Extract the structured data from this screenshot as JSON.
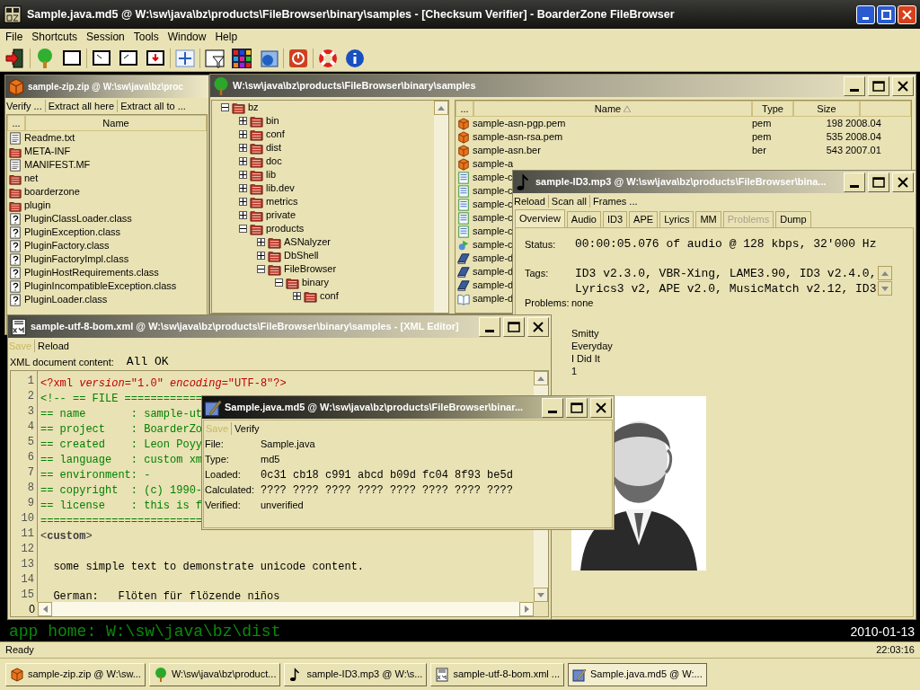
{
  "window": {
    "title": "Sample.java.md5 @ W:\\sw\\java\\bz\\products\\FileBrowser\\binary\\samples - [Checksum Verifier] - BoarderZone FileBrowser"
  },
  "menu": [
    "File",
    "Shortcuts",
    "Session",
    "Tools",
    "Window",
    "Help"
  ],
  "zip_window": {
    "title": "sample-zip.zip @ W:\\sw\\java\\bz\\proc",
    "actions": [
      "Verify ...",
      "Extract all here",
      "Extract all to ..."
    ],
    "columns": [
      "...",
      "Name"
    ],
    "rows": [
      {
        "name": "Readme.txt",
        "kind": "text"
      },
      {
        "name": "META-INF",
        "kind": "folder"
      },
      {
        "name": "MANIFEST.MF",
        "kind": "text"
      },
      {
        "name": "net",
        "kind": "folder"
      },
      {
        "name": "boarderzone",
        "kind": "folder"
      },
      {
        "name": "plugin",
        "kind": "folder"
      },
      {
        "name": "PluginClassLoader.class",
        "kind": "unknown"
      },
      {
        "name": "PluginException.class",
        "kind": "unknown"
      },
      {
        "name": "PluginFactory.class",
        "kind": "unknown"
      },
      {
        "name": "PluginFactoryImpl.class",
        "kind": "unknown"
      },
      {
        "name": "PluginHostRequirements.class",
        "kind": "unknown"
      },
      {
        "name": "PluginIncompatibleException.class",
        "kind": "unknown"
      },
      {
        "name": "PluginLoader.class",
        "kind": "unknown"
      }
    ]
  },
  "tree_window": {
    "title": "W:\\sw\\java\\bz\\products\\FileBrowser\\binary\\samples",
    "tree": [
      {
        "label": "bz",
        "expanded": true,
        "children": [
          {
            "label": "bin",
            "expanded": false
          },
          {
            "label": "conf",
            "expanded": false
          },
          {
            "label": "dist",
            "expanded": false
          },
          {
            "label": "doc",
            "expanded": false
          },
          {
            "label": "lib",
            "expanded": false
          },
          {
            "label": "lib.dev",
            "expanded": false
          },
          {
            "label": "metrics",
            "expanded": false
          },
          {
            "label": "private",
            "expanded": false
          },
          {
            "label": "products",
            "expanded": true,
            "children": [
              {
                "label": "ASNalyzer",
                "expanded": false
              },
              {
                "label": "DbShell",
                "expanded": false
              },
              {
                "label": "FileBrowser",
                "expanded": true,
                "children": [
                  {
                    "label": "binary",
                    "expanded": true,
                    "children": [
                      {
                        "label": "conf",
                        "expanded": false
                      }
                    ]
                  }
                ]
              }
            ]
          }
        ]
      }
    ],
    "columns": [
      {
        "label": "...",
        "sorted": false
      },
      {
        "label": "Name",
        "sorted": true
      },
      {
        "label": "Type",
        "sorted": false
      },
      {
        "label": "Size",
        "sorted": false
      }
    ],
    "files": [
      {
        "name": "sample-asn-pgp.pem",
        "type": "pem",
        "size": "198",
        "date": "2008.04",
        "kind": "package"
      },
      {
        "name": "sample-asn-rsa.pem",
        "type": "pem",
        "size": "535",
        "date": "2008.04",
        "kind": "package"
      },
      {
        "name": "sample-asn.ber",
        "type": "ber",
        "size": "543",
        "date": "2007.01",
        "kind": "package"
      },
      {
        "name": "sample-a",
        "kind": "package"
      },
      {
        "name": "sample-c",
        "kind": "sheet"
      },
      {
        "name": "sample-c",
        "kind": "sheet"
      },
      {
        "name": "sample-c",
        "kind": "sheet"
      },
      {
        "name": "sample-c",
        "kind": "sheet"
      },
      {
        "name": "sample-c",
        "kind": "sheet"
      },
      {
        "name": "sample-c",
        "kind": "script"
      },
      {
        "name": "sample-d",
        "kind": "book"
      },
      {
        "name": "sample-d",
        "kind": "book"
      },
      {
        "name": "sample-d",
        "kind": "book"
      },
      {
        "name": "sample-d",
        "kind": "manual"
      }
    ]
  },
  "id3_window": {
    "title": "sample-ID3.mp3 @ W:\\sw\\java\\bz\\products\\FileBrowser\\bina...",
    "actions": [
      "Reload",
      "Scan all",
      "Frames ..."
    ],
    "tabs": [
      {
        "label": "Overview",
        "selected": true,
        "disabled": false
      },
      {
        "label": "Audio",
        "selected": false,
        "disabled": false
      },
      {
        "label": "ID3",
        "selected": false,
        "disabled": false
      },
      {
        "label": "APE",
        "selected": false,
        "disabled": false
      },
      {
        "label": "Lyrics",
        "selected": false,
        "disabled": false
      },
      {
        "label": "MM",
        "selected": false,
        "disabled": false
      },
      {
        "label": "Problems",
        "selected": false,
        "disabled": true
      },
      {
        "label": "Dump",
        "selected": false,
        "disabled": false
      }
    ],
    "status_label": "Status:",
    "status": "00:00:05.076 of audio @ 128 kbps, 32'000 Hz",
    "tags_label": "Tags:",
    "tags": [
      "ID3 v2.3.0, VBR-Xing, LAME3.90, ID3 v2.4.0,",
      "Lyrics3 v2, APE v2.0, MusicMatch v2.12, ID3"
    ],
    "problems_label": "Problems:",
    "problems": "none",
    "info": [
      "Smitty",
      "Everyday",
      "I Did It",
      "1"
    ]
  },
  "xml_window": {
    "title": "sample-utf-8-bom.xml @ W:\\sw\\java\\bz\\products\\FileBrowser\\binary\\samples - [XML Editor]",
    "actions": [
      {
        "label": "Save",
        "disabled": true
      },
      {
        "label": "Reload",
        "disabled": false
      }
    ],
    "content_label": "XML document content:",
    "content_status": "All OK",
    "lines": [
      {
        "number": "1",
        "kind": "declaration",
        "text": "<?xml *version*=\"1.0\" *encoding*=\"UTF-8\"?>"
      },
      {
        "number": "2",
        "kind": "comment",
        "text": "<!-- == FILE ============"
      },
      {
        "number": "3",
        "kind": "comment",
        "text": "== name       : sample-ut"
      },
      {
        "number": "4",
        "kind": "comment",
        "text": "== project    : BoarderZo"
      },
      {
        "number": "5",
        "kind": "comment",
        "text": "== created    : Leon Poyy"
      },
      {
        "number": "6",
        "kind": "comment",
        "text": "== language   : custom xm"
      },
      {
        "number": "7",
        "kind": "comment",
        "text": "== environment: -"
      },
      {
        "number": "8",
        "kind": "comment",
        "text": "== copyright  : (c) 1990-"
      },
      {
        "number": "9",
        "kind": "comment",
        "text": "== license    : this is f"
      },
      {
        "number": "10",
        "kind": "comment",
        "text": "========================="
      },
      {
        "number": "11",
        "kind": "element",
        "text": "<**custom**>"
      },
      {
        "number": "12",
        "kind": "blank"
      },
      {
        "number": "13",
        "kind": "text",
        "text": "  some simple text to demonstrate unicode content."
      },
      {
        "number": "14",
        "kind": "blank"
      },
      {
        "number": "15",
        "kind": "text",
        "text": "  German:   Flöten für flözende niños"
      }
    ],
    "column": "0"
  },
  "md5_window": {
    "title": "Sample.java.md5 @ W:\\sw\\java\\bz\\products\\FileBrowser\\binar...",
    "actions": [
      {
        "label": "Save",
        "disabled": true
      },
      {
        "label": "Verify",
        "disabled": false
      }
    ],
    "fields": [
      {
        "label": "File:",
        "value": "Sample.java",
        "kind": "plain"
      },
      {
        "label": "Type:",
        "value": "md5",
        "kind": "plain"
      },
      {
        "label": "Loaded:",
        "value": "0c31 cb18 c991 abcd b09d fc04 8f93 be5d",
        "kind": "hash"
      },
      {
        "label": "Calculated:",
        "value": "???? ???? ???? ???? ???? ???? ???? ????",
        "kind": "hash"
      },
      {
        "label": "Verified:",
        "value": "unverified",
        "kind": "plain"
      }
    ]
  },
  "console": {
    "text": "app home: W:\\sw\\java\\bz\\dist",
    "date": "2010-01-13"
  },
  "status_bar": {
    "text": "Ready",
    "time": "22:03:16"
  },
  "taskbar": [
    {
      "label": "sample-zip.zip @ W:\\sw...",
      "kind": "package",
      "selected": false
    },
    {
      "label": "W:\\sw\\java\\bz\\product...",
      "kind": "tree",
      "selected": false
    },
    {
      "label": "sample-ID3.mp3 @ W:\\s...",
      "kind": "music",
      "selected": false
    },
    {
      "label": "sample-utf-8-bom.xml ...",
      "kind": "xml",
      "selected": false
    },
    {
      "label": "Sample.java.md5 @ W:...",
      "kind": "md5",
      "selected": true
    }
  ]
}
